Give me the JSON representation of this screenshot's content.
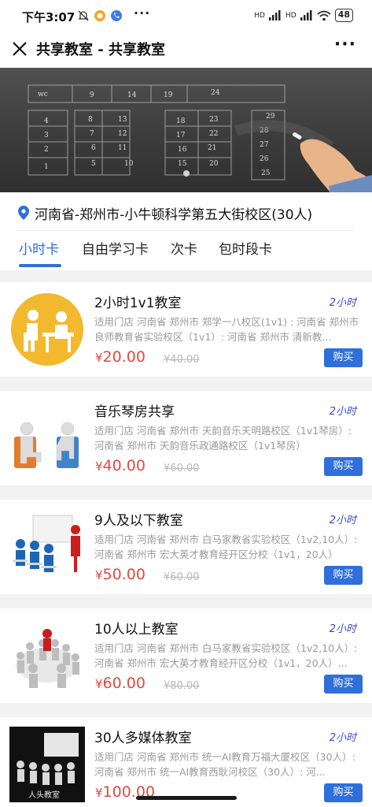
{
  "status_bar": {
    "time": "下午3:07",
    "network1": "HD",
    "network2": "HD",
    "battery": "48"
  },
  "nav": {
    "title": "共享教室 - 共享教室"
  },
  "banner": {
    "grid_labels": [
      "wc",
      "9",
      "14",
      "19",
      "24",
      "4",
      "3",
      "2",
      "1",
      "8",
      "7",
      "6",
      "5",
      "13",
      "12",
      "11",
      "10",
      "18",
      "17",
      "16",
      "15",
      "23",
      "22",
      "21",
      "20",
      "29",
      "28",
      "27",
      "26",
      "25"
    ]
  },
  "location": {
    "text": "河南省-郑州市-小牛顿科学第五大街校区(30人)"
  },
  "tabs": [
    {
      "label": "小时卡"
    },
    {
      "label": "自由学习卡"
    },
    {
      "label": "次卡"
    },
    {
      "label": "包时段卡"
    }
  ],
  "products": [
    {
      "name": "2小时1v1教室",
      "duration": "2小时",
      "description": "适用门店 河南省 郑州市 郑学一八校区(1v1) : 河南省 郑州市 良师教育省实验校区（1v1）: 河南省 郑州市 清新教...",
      "price": "20.00",
      "original_price": "¥40.00",
      "buy_label": "购买",
      "image": "one-on-one-tutoring-icon"
    },
    {
      "name": "音乐琴房共享",
      "duration": "2小时",
      "description": "适用门店 河南省 郑州市 天韵音乐天明路校区（1v1琴房）: 河南省 郑州市 天韵音乐政通路校区（1v1琴房）",
      "price": "40.00",
      "original_price": "¥60.00",
      "buy_label": "购买",
      "image": "music-room-figures"
    },
    {
      "name": "9人及以下教室",
      "duration": "2小时",
      "description": "适用门店 河南省 郑州市 白马家教省实验校区（1v2,10人）: 河南省 郑州市 宏大英才教育经开区分校（1v1，20人）",
      "price": "50.00",
      "original_price": "¥60.00",
      "buy_label": "购买",
      "image": "small-class-figures"
    },
    {
      "name": "10人以上教室",
      "duration": "2小时",
      "description": "适用门店 河南省 郑州市 白马家教省实验校区（1v2,10人）: 河南省 郑州市 宏大英才教育经开区分校（1v1，20人）...",
      "price": "60.00",
      "original_price": "¥80.00",
      "buy_label": "购买",
      "image": "circle-meeting-figures"
    },
    {
      "name": "30人多媒体教室",
      "duration": "2小时",
      "description": "适用门店 河南省 郑州市 统一AI教育万福大厦校区（30人）: 河南省 郑州市 统一AI教育西耿河校区（30人）: 河...",
      "price": "100.00",
      "original_price": "",
      "buy_label": "购买",
      "image": "multimedia-classroom"
    }
  ],
  "thumb_captions": {
    "multimedia": "人头教室"
  },
  "currency": "¥",
  "colors": {
    "accent": "#2f6fdb",
    "price": "#e24a40",
    "duration": "#3a47c9"
  }
}
